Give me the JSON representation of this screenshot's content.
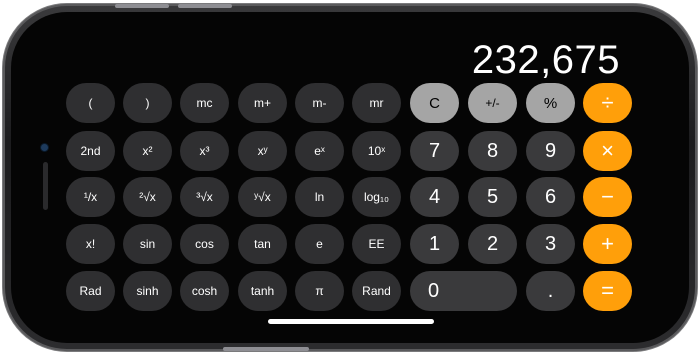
{
  "display": {
    "value": "232,675"
  },
  "keys": {
    "row1": [
      "(",
      ")",
      "mc",
      "m+",
      "m-",
      "mr",
      "C",
      "+/-",
      "%",
      "÷"
    ],
    "row2": [
      "2nd",
      "x²",
      "x³",
      "xʸ",
      "eˣ",
      "10ˣ",
      "7",
      "8",
      "9",
      "×"
    ],
    "row3": [
      "¹/x",
      "²√x",
      "³√x",
      "ʸ√x",
      "ln",
      "log₁₀",
      "4",
      "5",
      "6",
      "−"
    ],
    "row4": [
      "x!",
      "sin",
      "cos",
      "tan",
      "e",
      "EE",
      "1",
      "2",
      "3",
      "+"
    ],
    "row5": [
      "Rad",
      "sinh",
      "cosh",
      "tanh",
      "π",
      "Rand",
      "0",
      ".",
      "="
    ]
  },
  "colors": {
    "operator": "#ff9f0a",
    "function": "#a5a5a5",
    "digit": "#3a3a3c",
    "scientific": "#2f2f31",
    "background": "#050505"
  }
}
